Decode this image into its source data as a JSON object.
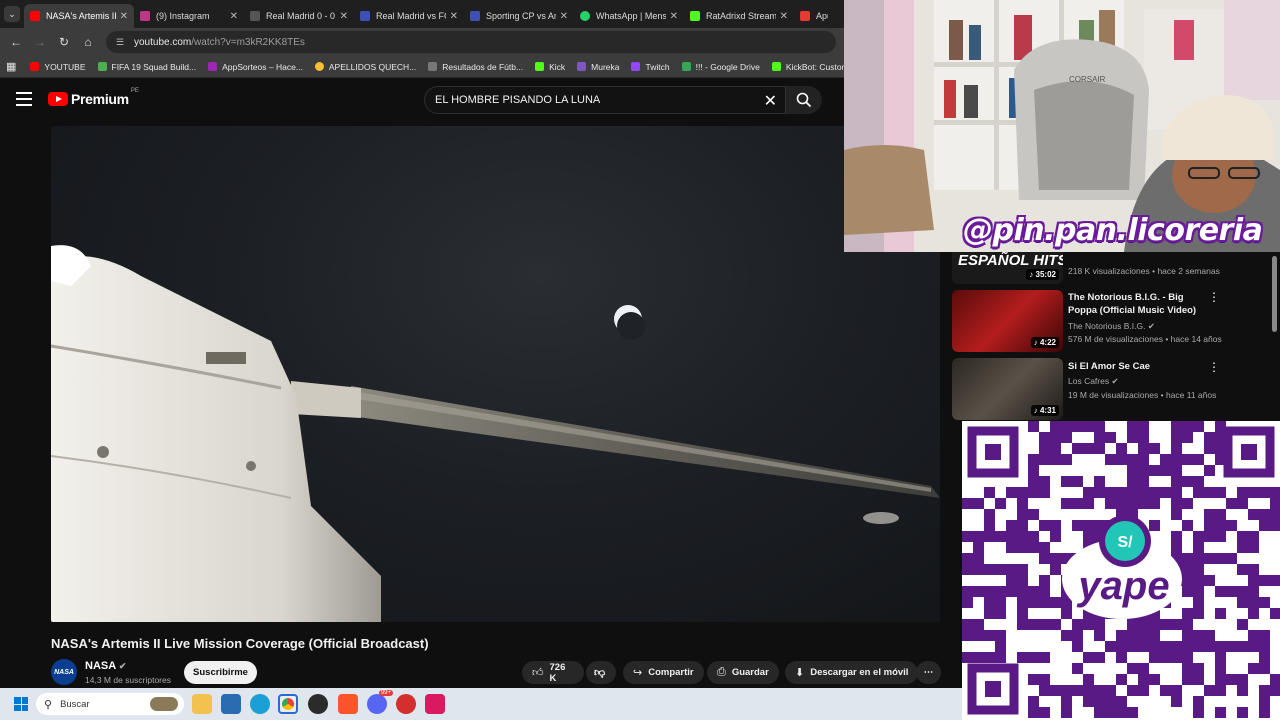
{
  "browser": {
    "tabs": [
      {
        "title": "NASA's Artemis II",
        "active": true,
        "favicon_color": "#ff0000"
      },
      {
        "title": "(9) Instagram",
        "active": false,
        "favicon_color": "#c13584"
      },
      {
        "title": "Real Madrid 0 - 0",
        "active": false,
        "favicon_color": "#555555"
      },
      {
        "title": "Real Madrid vs FC",
        "active": false,
        "favicon_color": "#3f51b5"
      },
      {
        "title": "Sporting CP vs Ar",
        "active": false,
        "favicon_color": "#3f51b5"
      },
      {
        "title": "WhatsApp | Mens",
        "active": false,
        "favicon_color": "#25d366"
      },
      {
        "title": "RatAdrixd Stream",
        "active": false,
        "favicon_color": "#53fc18"
      },
      {
        "title": "Apue",
        "active": false,
        "favicon_color": "#e53935"
      }
    ],
    "url_domain": "youtube.com",
    "url_path": "/watch?v=m3kR2KK8TEs",
    "bookmarks": [
      {
        "label": "YOUTUBE",
        "color": "#ff0000"
      },
      {
        "label": "FIFA 19 Squad Build...",
        "color": "#4caf50"
      },
      {
        "label": "AppSorteos – Hace...",
        "color": "#9c27b0"
      },
      {
        "label": "APELLIDOS QUECH...",
        "color": "#fbc02d"
      },
      {
        "label": "Resultados de Fútb...",
        "color": "#777777"
      },
      {
        "label": "Kick",
        "color": "#53fc18"
      },
      {
        "label": "Mureka",
        "color": "#7e57c2"
      },
      {
        "label": "Twitch",
        "color": "#9146ff"
      },
      {
        "label": "!!! - Google Drive",
        "color": "#34a853"
      },
      {
        "label": "KickBot: Customiza...",
        "color": "#53fc18"
      }
    ]
  },
  "youtube": {
    "logo_text": "Premium",
    "logo_country": "PE",
    "search_query": "EL HOMBRE PISANDO LA LUNA",
    "video": {
      "title": "NASA's Artemis II Live Mission Coverage (Official Broadcast)",
      "channel": "NASA",
      "subscribers": "14,3 M de suscriptores",
      "avatar_text": "NASA",
      "subscribe_label": "Suscribirme",
      "likes": "726 K",
      "share_label": "Compartir",
      "save_label": "Guardar",
      "download_label": "Descargar en el móvil"
    },
    "recommendations": [
      {
        "title": "",
        "thumb_text": "ESPAÑOL HITS",
        "channel": "",
        "meta": "218 K visualizaciones • hace 2 semanas",
        "duration": "35:02",
        "thumb_color": "#1a1a1a"
      },
      {
        "title": "The Notorious B.I.G. - Big Poppa (Official Music Video)",
        "channel": "The Notorious B.I.G.",
        "meta": "576 M de visualizaciones • hace 14 años",
        "duration": "4:22",
        "thumb_color": "#7a1010"
      },
      {
        "title": "Si El Amor Se Cae",
        "channel": "Los Cafres",
        "meta": "19 M de visualizaciones • hace 11 años",
        "duration": "4:31",
        "thumb_color": "#3a3530"
      }
    ]
  },
  "overlay": {
    "brand_handle": "@pin.pan.licoreria",
    "yape_badge": "S/",
    "yape_text": "yape"
  },
  "taskbar": {
    "search_placeholder": "Buscar",
    "badge_count": "99+"
  }
}
